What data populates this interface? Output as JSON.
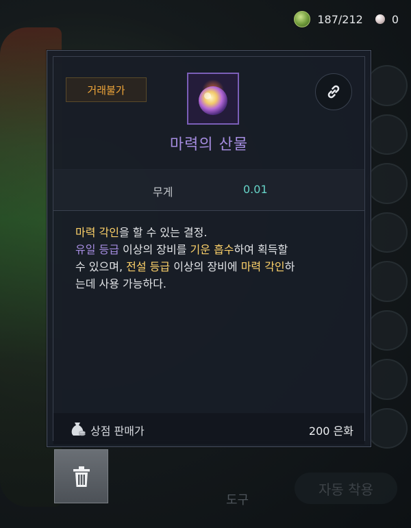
{
  "currency": {
    "inventory_count": "187/212",
    "pearl_count": "0"
  },
  "tooltip": {
    "badge_label": "거래불가",
    "item_name": "마력의 산물",
    "stat_label": "무게",
    "stat_value": "0.01",
    "description": {
      "line1_part1": "마력 각인",
      "line1_part2": "을 할 수 있는 결정.",
      "line2_part1": "유일 등급",
      "line2_part2": " 이상의 장비를 ",
      "line2_part3": "기운 흡수",
      "line2_part4": "하여 획득할",
      "line3_part1": "수 있으며, ",
      "line3_part2": "전설 등급",
      "line3_part3": " 이상의 장비에 ",
      "line3_part4": "마력 각인",
      "line3_part5": "하",
      "line4": "는데 사용 가능하다."
    },
    "price_label": "상점 판매가",
    "price_value": "200 은화"
  },
  "background": {
    "bottom_label": "자동 착용",
    "bottom_center_label": "도구"
  },
  "icons": {
    "inventory_icon": "green-orb-icon",
    "pearl_icon": "pearl-icon",
    "link_icon": "link-icon",
    "item_icon": "magic-orb-icon",
    "price_icon": "money-bag-icon",
    "trash_icon": "trash-icon"
  },
  "colors": {
    "badge_text": "#f0a63a",
    "item_name": "#a58ce0",
    "stat_value": "#66d3c7",
    "highlight_yellow": "#ffd36a",
    "highlight_purple": "#a58ce0"
  }
}
